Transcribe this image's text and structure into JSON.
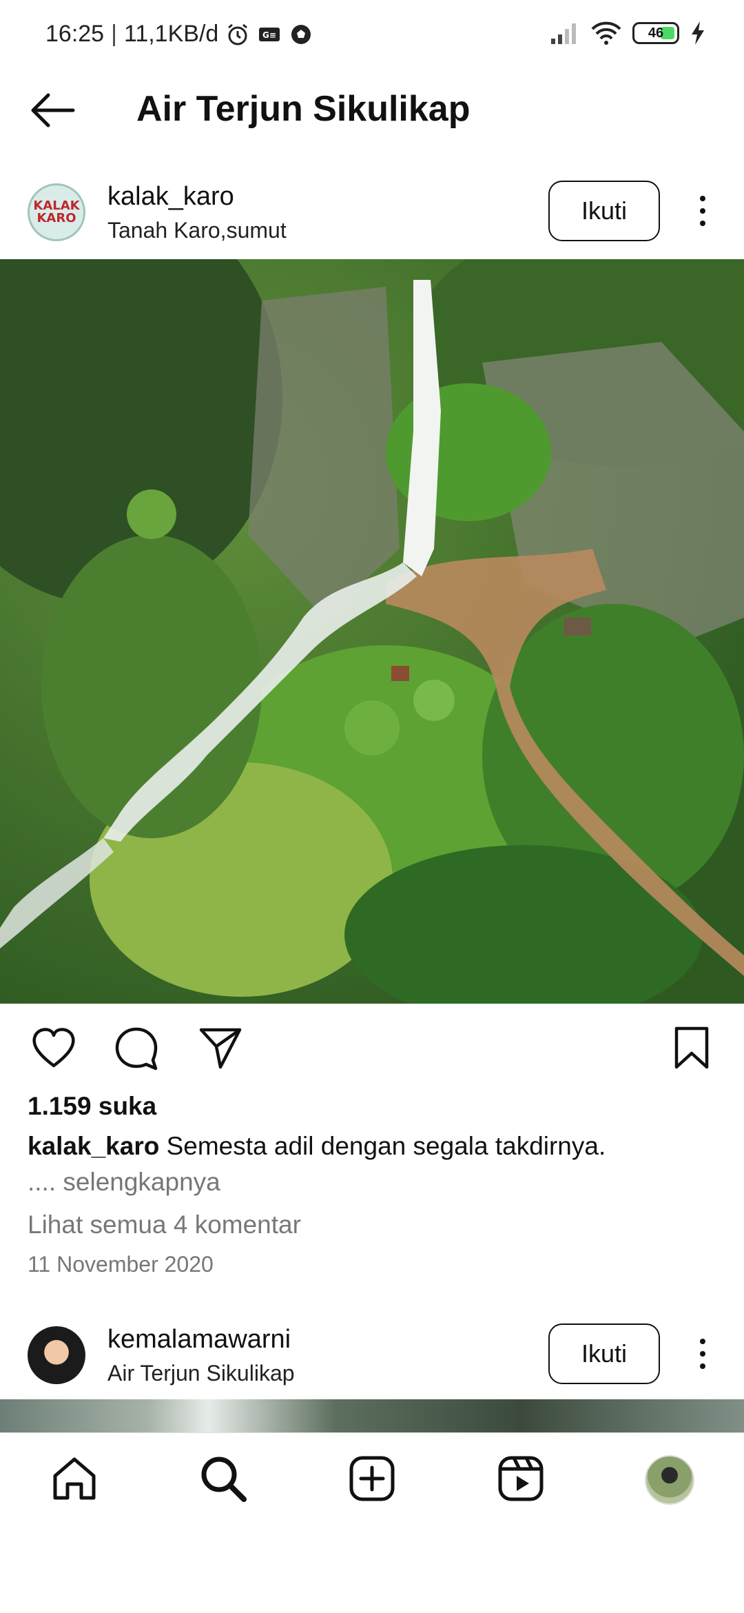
{
  "status_bar": {
    "time": "16:25",
    "network_speed": "11,1KB/d",
    "battery_level": "46",
    "icons": [
      "alarm-icon",
      "sim-icon",
      "soccer-ball-icon",
      "signal-icon",
      "wifi-icon",
      "battery-icon",
      "charging-icon"
    ]
  },
  "header": {
    "title": "Air Terjun Sikulikap",
    "back_icon": "arrow-left-icon"
  },
  "posts": [
    {
      "username": "kalak_karo",
      "location": "Tanah Karo,sumut",
      "avatar_text": "KALAK KARO",
      "follow_label": "Ikuti",
      "likes": "1.159 suka",
      "caption_user": "kalak_karo",
      "caption_text": " Semesta adil dengan segala takdirnya.",
      "more_label": ".... selengkapnya",
      "comments_label": "Lihat semua 4 komentar",
      "date": "11 November 2020"
    },
    {
      "username": "kemalamawarni",
      "location": "Air Terjun Sikulikap",
      "follow_label": "Ikuti"
    }
  ],
  "actions": [
    "heart-icon",
    "comment-icon",
    "share-icon",
    "bookmark-icon"
  ],
  "bottom_nav": [
    "home-icon",
    "search-icon",
    "add-post-icon",
    "reels-icon",
    "profile-avatar"
  ],
  "colors": {
    "text": "#111111",
    "muted": "#777777",
    "battery_fill": "#4cd964",
    "logo_red": "#c0262d"
  }
}
